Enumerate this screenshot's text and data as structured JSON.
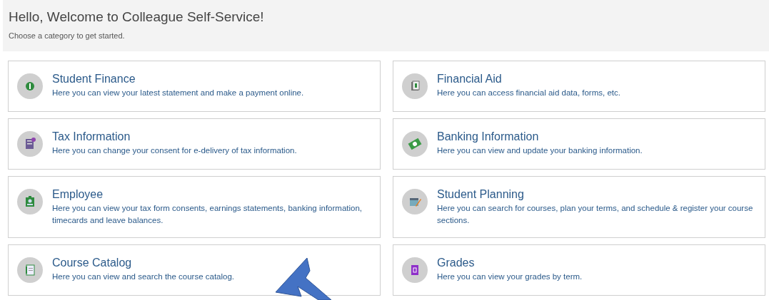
{
  "header": {
    "title": "Hello, Welcome to Colleague Self-Service!",
    "subtitle": "Choose a category to get started."
  },
  "categories": [
    {
      "kind": "finance",
      "title": "Student Finance",
      "description": "Here you can view your latest statement and make a payment online."
    },
    {
      "kind": "aid",
      "title": "Financial Aid",
      "description": "Here you can access financial aid data, forms, etc."
    },
    {
      "kind": "tax",
      "title": "Tax Information",
      "description": "Here you can change your consent for e-delivery of tax information."
    },
    {
      "kind": "banking",
      "title": "Banking Information",
      "description": "Here you can view and update your banking information."
    },
    {
      "kind": "employee",
      "title": "Employee",
      "description": "Here you can view your tax form consents, earnings statements, banking information, timecards and leave balances."
    },
    {
      "kind": "planning",
      "title": "Student Planning",
      "description": "Here you can search for courses, plan your terms, and schedule & register your course sections."
    },
    {
      "kind": "catalog",
      "title": "Course Catalog",
      "description": "Here you can view and search the course catalog."
    },
    {
      "kind": "grades",
      "title": "Grades",
      "description": "Here you can view your grades by term."
    }
  ]
}
